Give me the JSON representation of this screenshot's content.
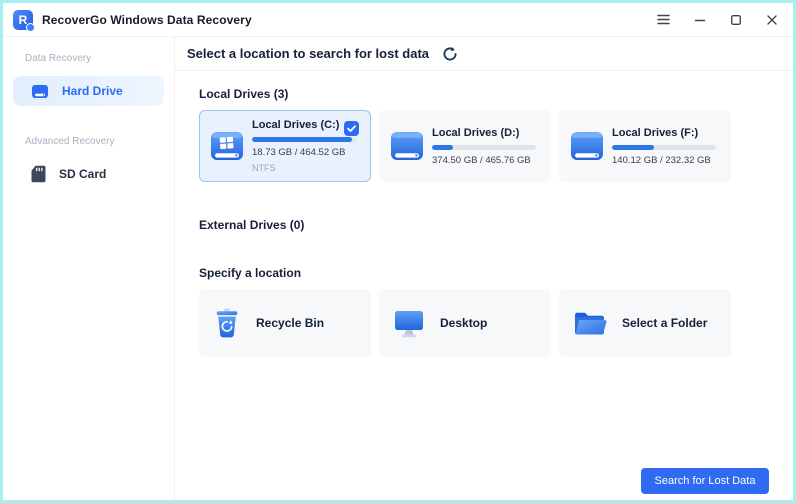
{
  "window": {
    "logo_text": "R",
    "title": "RecoverGo Windows Data Recovery",
    "control_icons": [
      "menu-icon",
      "minimize-icon",
      "maximize-icon",
      "close-icon"
    ]
  },
  "colors": {
    "accent_blue": "#2e6bf0",
    "frame_border": "#a9eef1",
    "selected_card_bg": "#e8f1fd",
    "card_bg": "#f7f8fa",
    "progress_fill": "#2e78e6"
  },
  "sidebar": {
    "sections": [
      {
        "label": "Data Recovery",
        "items": [
          {
            "label": "Hard Drive",
            "icon": "hard-drive-icon",
            "active": true
          }
        ]
      },
      {
        "label": "Advanced Recovery",
        "items": [
          {
            "label": "SD Card",
            "icon": "sd-card-icon",
            "active": false
          }
        ]
      }
    ]
  },
  "main": {
    "header": {
      "title": "Select a location to search for lost data",
      "icon": "refresh-icon"
    },
    "local_drives": {
      "heading": "Local Drives (3)",
      "drives": [
        {
          "name": "Local Drives (C:)",
          "capacity": "18.73 GB / 464.52 GB",
          "filesystem": "NTFS",
          "used_percent": 96,
          "selected": true
        },
        {
          "name": "Local Drives (D:)",
          "capacity": "374.50 GB / 465.76 GB",
          "used_percent": 20,
          "selected": false
        },
        {
          "name": "Local Drives (F:)",
          "capacity": "140.12 GB / 232.32 GB",
          "used_percent": 40,
          "selected": false
        }
      ]
    },
    "external_drives": {
      "heading": "External Drives (0)"
    },
    "specify_location": {
      "heading": "Specify a location",
      "locations": [
        {
          "label": "Recycle Bin",
          "icon": "recycle-bin-icon"
        },
        {
          "label": "Desktop",
          "icon": "desktop-icon"
        },
        {
          "label": "Select a Folder",
          "icon": "folder-icon"
        }
      ]
    },
    "footer": {
      "search_button": "Search for Lost Data"
    }
  }
}
